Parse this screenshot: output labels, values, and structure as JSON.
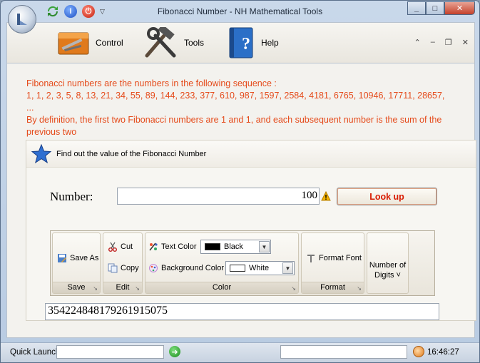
{
  "window": {
    "title": "Fibonacci Number - NH Mathematical Tools",
    "controls": {
      "minimize": "_",
      "maximize": "□",
      "close": "✕"
    }
  },
  "ribbon": {
    "tabs": [
      {
        "label": "Control",
        "icon": "toolbox-icon"
      },
      {
        "label": "Tools",
        "icon": "hammer-wrench-icon"
      },
      {
        "label": "Help",
        "icon": "help-book-icon"
      }
    ],
    "right_controls": {
      "collapse": "⌃",
      "minimize": "–",
      "restore": "❐",
      "close": "✕"
    }
  },
  "description": {
    "line1": "Fibonacci numbers are the numbers in the following sequence :",
    "line2": "1, 1, 2, 3, 5, 8, 13, 21, 34, 55, 89, 144, 233, 377, 610, 987, 1597, 2584, 4181, 6765, 10946, 17711, 28657, ...",
    "line3": "By definition, the first two Fibonacci numbers are 1 and 1, and each subsequent number is the sum of the previous two"
  },
  "panel": {
    "header": "Find out the value of the Fibonacci Number",
    "number_label": "Number:",
    "number_value": "100",
    "lookup_button": "Look up"
  },
  "toolbar": {
    "save": {
      "save_as": "Save As",
      "group": "Save"
    },
    "edit": {
      "cut": "Cut",
      "copy": "Copy",
      "group": "Edit"
    },
    "color": {
      "text_color_label": "Text Color",
      "text_color_value": "Black",
      "text_color_hex": "#000000",
      "background_color_label": "Background Color",
      "background_color_value": "White",
      "background_color_hex": "#ffffff",
      "group": "Color"
    },
    "format": {
      "format_font": "Format Font",
      "group": "Format"
    },
    "digits": {
      "label_line1": "Number of",
      "label_line2": "Digits ˅"
    }
  },
  "result": {
    "value": "354224848179261915075"
  },
  "statusbar": {
    "quick_launch_label": "Quick Launch",
    "time": "16:46:27"
  },
  "colors": {
    "accent_text": "#e54b1b",
    "lookup_text": "#d81a00"
  }
}
